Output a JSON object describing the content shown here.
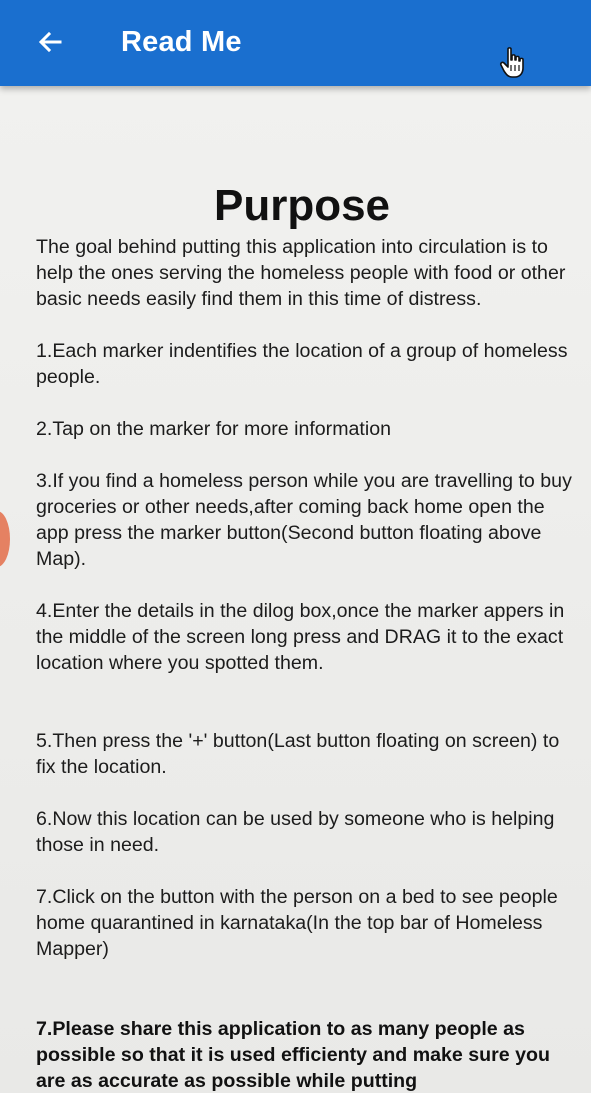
{
  "app_bar": {
    "title": "Read Me",
    "back_icon": "arrow-left-icon",
    "background": "#1a6fcf"
  },
  "content": {
    "heading": "Purpose",
    "intro": "The goal behind putting this application into circulation is to help the ones serving the homeless people with food or other basic needs easily find them in this time of distress.",
    "steps": [
      "1.Each marker indentifies the location of a group of homeless people.",
      "2.Tap on the marker for more information",
      "3.If you find a homeless person while you are travelling to buy groceries or other needs,after coming back home open the app press the marker button(Second button floating above Map).",
      "4.Enter the details in the dilog box,once the marker appers in the middle of the screen long press and DRAG it to the exact location where you spotted them.",
      "5.Then press the '+' button(Last button floating on screen) to fix the location.",
      "6.Now this location can be used by someone who is helping those in need.",
      "7.Click on the button with the person on a bed to see people home quarantined in karnataka(In the top bar of Homeless Mapper)"
    ],
    "closing_note": "7.Please share this application to as many people as possible so that it is used efficienty and make sure you are as accurate as possible while putting"
  }
}
